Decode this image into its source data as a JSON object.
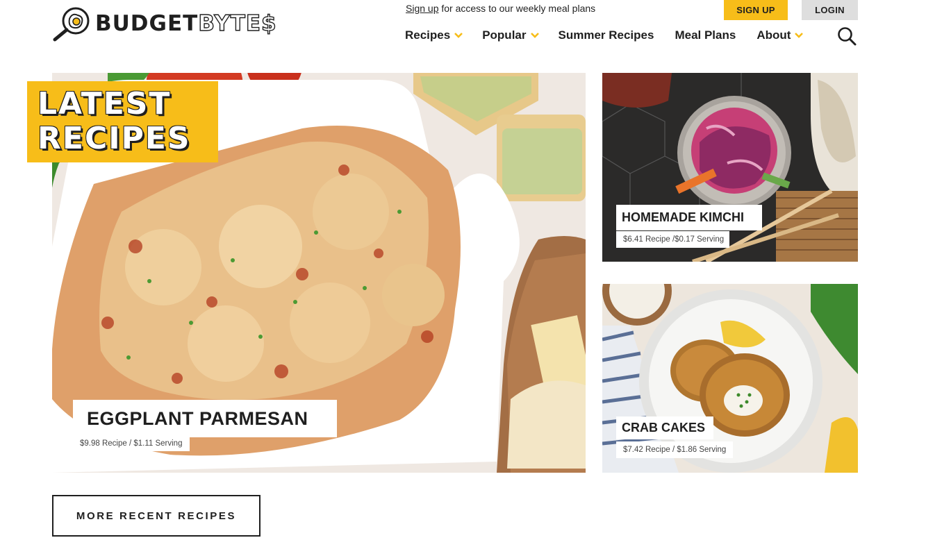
{
  "brand": {
    "name_part1": "BUDGET",
    "name_part2": "BYTE$",
    "accent_color": "#f7bd19"
  },
  "header": {
    "signup_link": "Sign up",
    "signup_note": " for access to our weekly meal plans",
    "signup_button": "SIGN UP",
    "login_button": "LOGIN",
    "nav": [
      {
        "label": "Recipes",
        "has_dropdown": true
      },
      {
        "label": "Popular",
        "has_dropdown": true
      },
      {
        "label": "Summer Recipes",
        "has_dropdown": false
      },
      {
        "label": "Meal Plans",
        "has_dropdown": false
      },
      {
        "label": "About",
        "has_dropdown": true
      }
    ],
    "search_icon": "search-icon"
  },
  "latest": {
    "line1": "LATEST",
    "line2": "RECIPES"
  },
  "featured": [
    {
      "title": "EGGPLANT PARMESAN",
      "price": "$9.98 Recipe / $1.11 Serving"
    },
    {
      "title": "HOMEMADE KIMCHI",
      "price": "$6.41 Recipe /$0.17 Serving"
    },
    {
      "title": "CRAB CAKES",
      "price": "$7.42 Recipe / $1.86 Serving"
    }
  ],
  "more_button": "MORE RECENT RECIPES"
}
